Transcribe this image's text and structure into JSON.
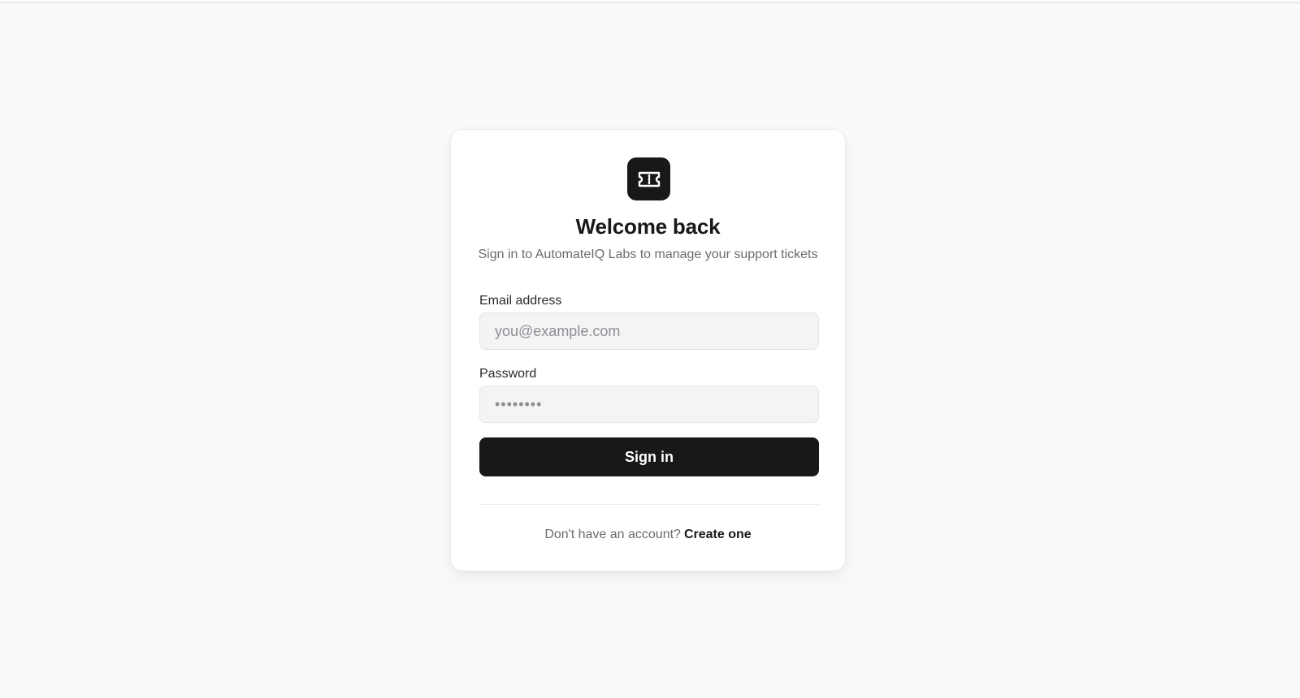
{
  "brand": {
    "logo_icon": "ticket-icon",
    "logo_bg_color": "#18181b",
    "accent_color": "#18181b"
  },
  "header": {
    "title": "Welcome back",
    "subtitle": "Sign in to AutomateIQ Labs to manage your support tickets"
  },
  "form": {
    "email": {
      "label": "Email address",
      "placeholder": "you@example.com",
      "value": ""
    },
    "password": {
      "label": "Password",
      "placeholder": "••••••••",
      "value": ""
    },
    "submit_label": "Sign in"
  },
  "footer": {
    "prompt": "Don't have an account?",
    "link_label": "Create one"
  }
}
